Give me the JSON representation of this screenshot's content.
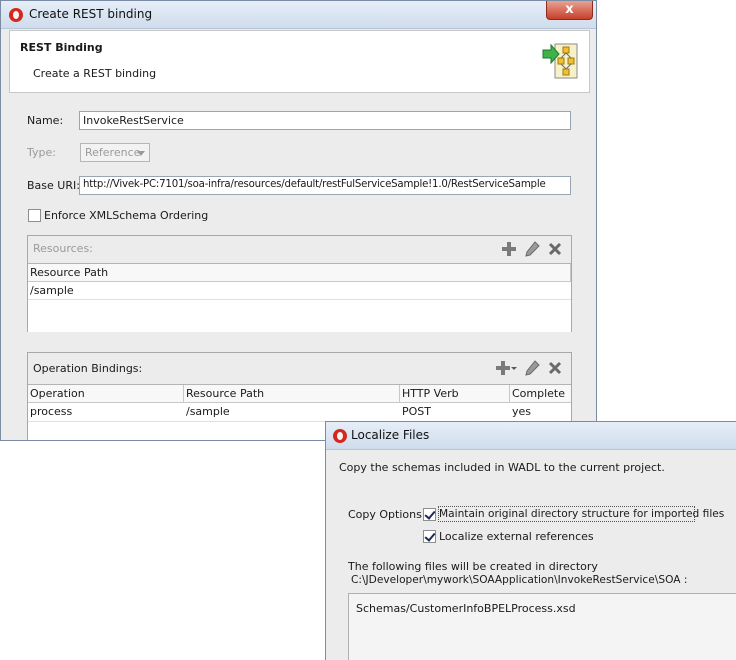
{
  "rest_dialog": {
    "title": "Create REST binding",
    "close_glyph": "x",
    "header_title": "REST Binding",
    "header_subtitle": "Create a REST binding",
    "header_icon": "rest-binding-wizard-icon",
    "name_label": "Name:",
    "name_value": "InvokeRestService",
    "type_label": "Type:",
    "type_value": "Reference",
    "base_uri_label": "Base URI:",
    "base_uri_value": "http://Vivek-PC:7101/soa-infra/resources/default/restFulServiceSample!1.0/RestServiceSample",
    "enforce_label": "Enforce XMLSchema Ordering",
    "enforce_checked": false,
    "resources": {
      "label": "Resources:",
      "columns": [
        "Resource Path"
      ],
      "rows": [
        [
          "/sample"
        ]
      ],
      "icons": [
        "add-icon",
        "edit-icon",
        "delete-icon"
      ]
    },
    "operations": {
      "label": "Operation Bindings:",
      "columns": [
        "Operation",
        "Resource Path",
        "HTTP Verb",
        "Complete"
      ],
      "rows": [
        [
          "process",
          "/sample",
          "POST",
          "yes"
        ]
      ],
      "icons": [
        "add-dropdown-icon",
        "edit-icon",
        "delete-icon"
      ]
    }
  },
  "localize_dialog": {
    "title": "Localize Files",
    "description": "Copy the schemas included in WADL to the current project.",
    "copy_options_label": "Copy Options:",
    "option_maintain": "Maintain original directory structure for imported files",
    "option_maintain_checked": true,
    "option_localize": "Localize external references",
    "option_localize_checked": true,
    "files_intro": "The following files will be created in directory",
    "files_directory": "C:\\JDeveloper\\mywork\\SOAApplication\\InvokeRestService\\SOA :",
    "files": [
      "Schemas/CustomerInfoBPELProcess.xsd"
    ]
  },
  "colors": {
    "titlebar": "#cfdcec",
    "close_button": "#c7402a",
    "dialog_bg": "#ececec",
    "oracle_logo": "#d7261d"
  }
}
